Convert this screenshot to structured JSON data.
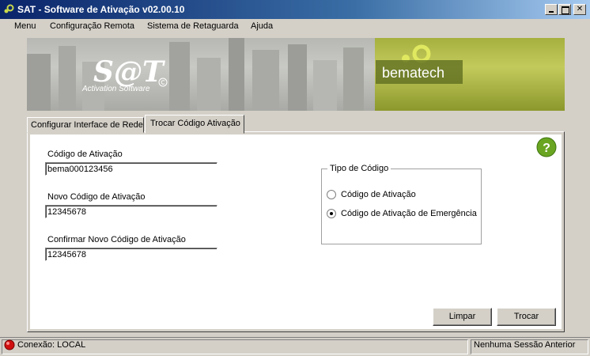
{
  "window": {
    "title": "SAT - Software de Ativação v02.00.10"
  },
  "menu": {
    "items": [
      "Menu",
      "Configuração Remota",
      "Sistema de Retaguarda",
      "Ajuda"
    ]
  },
  "banner": {
    "logo": "S@T",
    "subtitle": "Activation Software",
    "brand": "bematech"
  },
  "tabs": [
    {
      "label": "Configurar Interface de Rede",
      "active": false
    },
    {
      "label": "Trocar Código Ativação",
      "active": true
    }
  ],
  "form": {
    "codigo_label": "Código de Ativação",
    "codigo_value": "bema000123456",
    "novo_label": "Novo Código de Ativação",
    "novo_value": "12345678",
    "confirmar_label": "Confirmar Novo Código de Ativação",
    "confirmar_value": "12345678"
  },
  "tipo": {
    "title": "Tipo de Código",
    "options": [
      {
        "label": "Código de Ativação",
        "selected": false
      },
      {
        "label": "Código de Ativação de Emergência",
        "selected": true
      }
    ]
  },
  "buttons": {
    "limpar": "Limpar",
    "trocar": "Trocar",
    "help": "?"
  },
  "status": {
    "connection": "Conexão: LOCAL",
    "session": "Nenhuma Sessão Anterior"
  },
  "colors": {
    "title_start": "#0a246a",
    "title_end": "#a6caf0",
    "help_green": "#6aa521",
    "status_red": "#d01010"
  }
}
